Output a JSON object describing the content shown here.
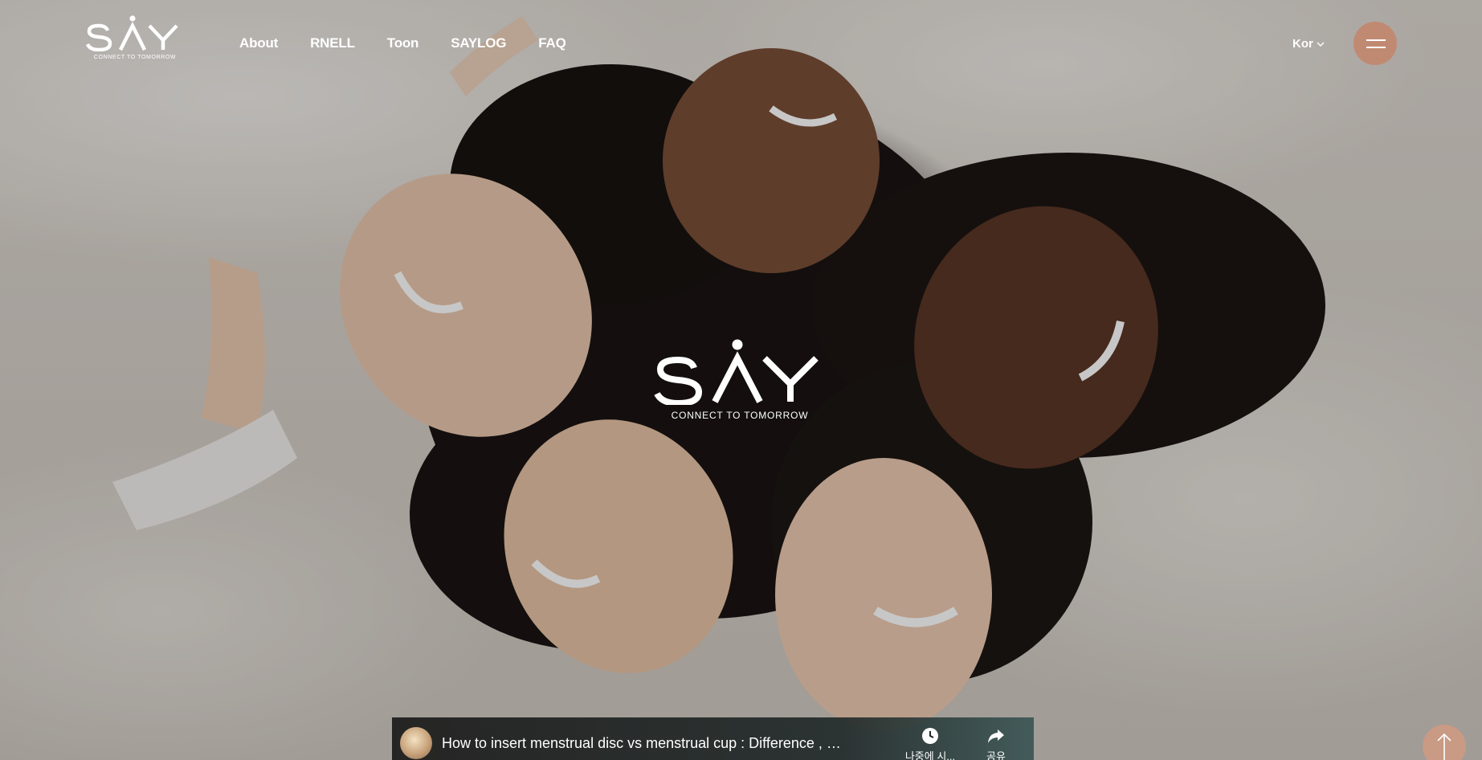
{
  "brand": {
    "name": "SAY",
    "tagline_small": "CONNECT TO TOMORROW",
    "tagline_center": "CONNECT TO TOMORROW"
  },
  "nav": {
    "items": [
      {
        "label": "About"
      },
      {
        "label": "RNELL"
      },
      {
        "label": "Toon"
      },
      {
        "label": "SAYLOG"
      },
      {
        "label": "FAQ"
      }
    ]
  },
  "language": {
    "selected": "Kor",
    "icon": "chevron-down-icon"
  },
  "menu": {
    "icon": "hamburger-icon"
  },
  "colors": {
    "accent": "#c08a72",
    "scroll_top": "#c99a84"
  },
  "video": {
    "title": "How to insert menstrual disc vs menstrual cup : Difference , Conveni...",
    "actions": [
      {
        "label": "나중에 시...",
        "icon": "clock-icon"
      },
      {
        "label": "공유",
        "icon": "share-icon"
      }
    ]
  },
  "scroll_top": {
    "icon": "arrow-up-icon"
  }
}
